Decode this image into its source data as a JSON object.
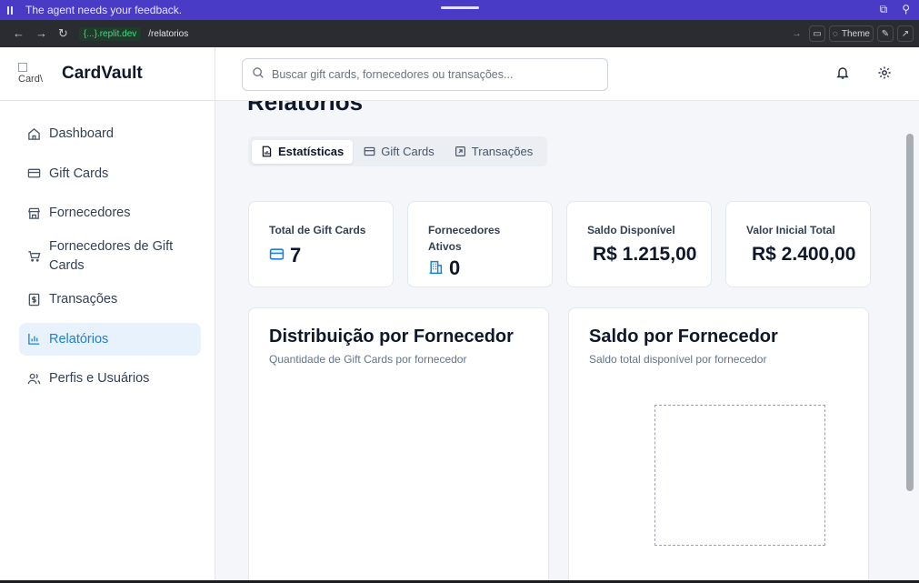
{
  "agent_bar": {
    "message": "The agent needs your feedback."
  },
  "browser": {
    "domain": "{...}.replit.dev",
    "path": "/relatorios",
    "theme_label": "Theme"
  },
  "app": {
    "name": "CardVault",
    "logo_alt": "Card\\"
  },
  "sidebar": {
    "items": [
      {
        "label": "Dashboard",
        "icon": "home-icon"
      },
      {
        "label": "Gift Cards",
        "icon": "card-icon"
      },
      {
        "label": "Fornecedores",
        "icon": "store-icon"
      },
      {
        "label": "Fornecedores de Gift Cards",
        "icon": "cart-icon"
      },
      {
        "label": "Transações",
        "icon": "receipt-icon"
      },
      {
        "label": "Relatórios",
        "icon": "bar-chart-icon",
        "active": true
      },
      {
        "label": "Perfis e Usuários",
        "icon": "users-icon"
      }
    ]
  },
  "search": {
    "placeholder": "Buscar gift cards, fornecedores ou transações..."
  },
  "page": {
    "title": "Relatórios"
  },
  "tabs": [
    {
      "label": "Estatísticas",
      "icon": "file-chart-icon",
      "active": true
    },
    {
      "label": "Gift Cards",
      "icon": "card-icon"
    },
    {
      "label": "Transações",
      "icon": "arrow-up-right-square-icon"
    }
  ],
  "stats": [
    {
      "label": "Total de Gift Cards",
      "value": "7",
      "icon": "card-icon"
    },
    {
      "label": "Fornecedores Ativos",
      "value": "0",
      "icon": "building-icon"
    },
    {
      "label": "Saldo Disponível",
      "value": "R$ 1.215,00"
    },
    {
      "label": "Valor Inicial Total",
      "value": "R$ 2.400,00"
    }
  ],
  "panels": [
    {
      "title": "Distribuição por Fornecedor",
      "subtitle": "Quantidade de Gift Cards por fornecedor"
    },
    {
      "title": "Saldo por Fornecedor",
      "subtitle": "Saldo total disponível por fornecedor"
    }
  ],
  "colors": {
    "accent": "#1e7fd8",
    "agent_bar": "#4a3bc7",
    "active_bg": "#e8f2fd"
  }
}
